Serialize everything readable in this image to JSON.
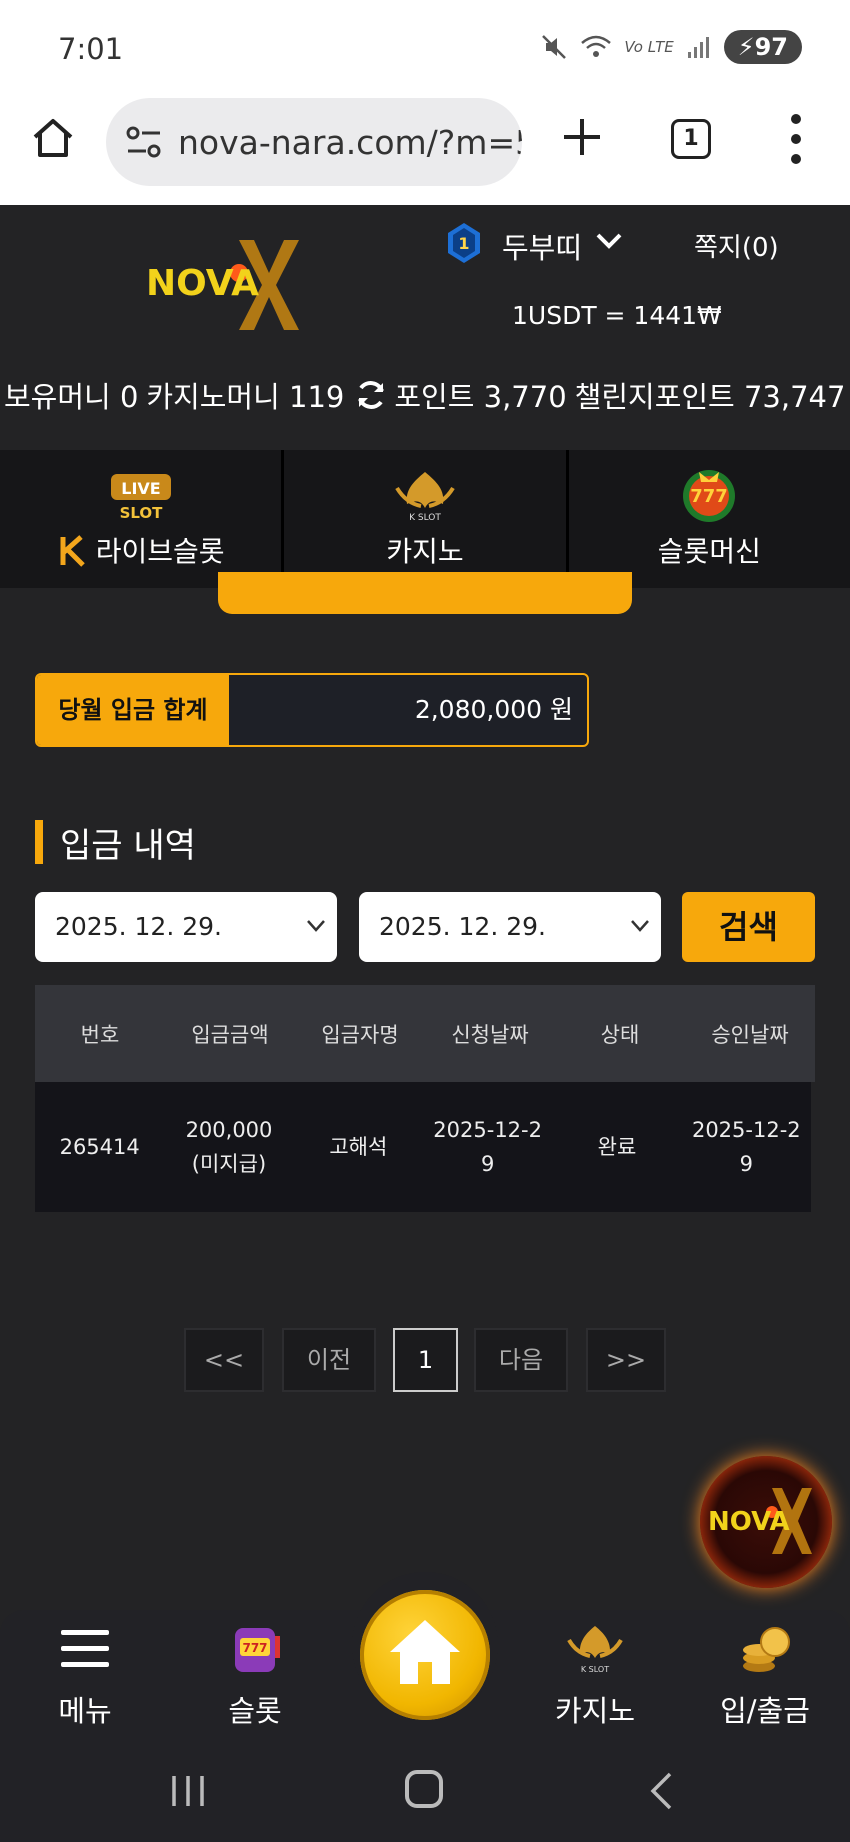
{
  "status_bar": {
    "time": "7:01",
    "network": "Vo LTE",
    "battery": "97"
  },
  "browser": {
    "url": "nova-nara.com/?m=5",
    "tab_count": "1"
  },
  "header": {
    "logo_text": "NOVA",
    "user_level": "1",
    "username": "두부띠",
    "messages_label": "쪽지(0)",
    "exchange_rate": "1USDT = 1441₩"
  },
  "balances": {
    "holding": "보유머니 0",
    "casino": "카지노머니 119",
    "points": "포인트 3,770",
    "challenge_points": "챌린지포인트 73,747"
  },
  "category_tabs": [
    {
      "label": "라이브슬롯",
      "icon": "live-slot-icon"
    },
    {
      "label": "카지노",
      "icon": "k-slot-icon"
    },
    {
      "label": "슬롯머신",
      "icon": "777-slots-icon"
    }
  ],
  "monthly_deposit": {
    "label": "당월 입금 합계",
    "value": "2,080,000 원"
  },
  "history": {
    "title": "입금 내역",
    "date_from": "2025. 12. 29.",
    "date_to": "2025. 12. 29.",
    "search_label": "검색",
    "columns": [
      "번호",
      "입금금액",
      "입금자명",
      "신청날짜",
      "상태",
      "승인날짜"
    ],
    "rows": [
      {
        "no": "265414",
        "amount": "200,000(미지급)",
        "depositor": "고해석",
        "requested": "2025-12-29",
        "status": "완료",
        "approved": "2025-12-29"
      }
    ]
  },
  "pagination": {
    "first": "<<",
    "prev": "이전",
    "current": "1",
    "next": "다음",
    "last": ">>"
  },
  "bottom_nav": {
    "menu": "메뉴",
    "slot": "슬롯",
    "casino": "카지노",
    "cashier": "입/출금"
  },
  "colors": {
    "accent": "#f7a80c",
    "background": "#232325",
    "table_header": "#34353a"
  }
}
